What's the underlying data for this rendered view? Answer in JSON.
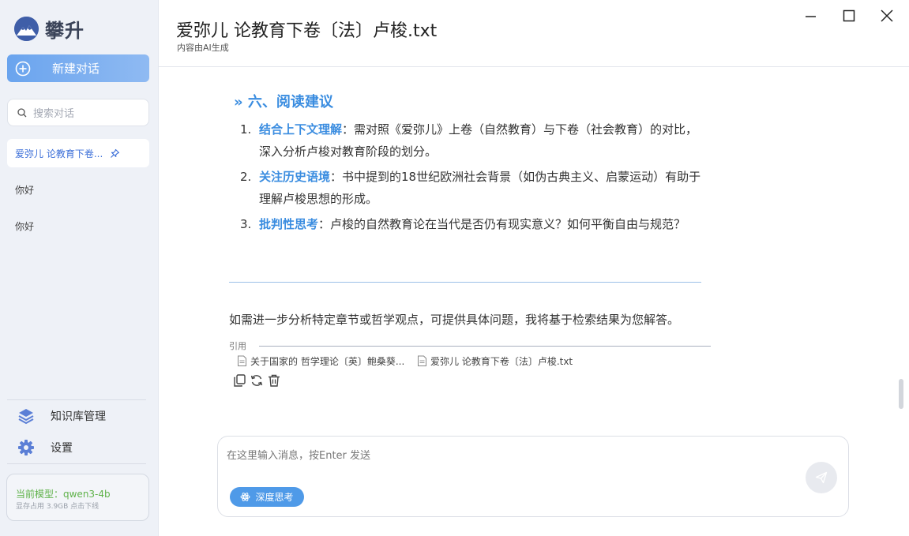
{
  "app": {
    "name": "攀升"
  },
  "sidebar": {
    "new_chat_label": "新建对话",
    "search_placeholder": "搜索对话",
    "conversations": [
      {
        "title": "爱弥儿 论教育下卷...",
        "pinned": true
      },
      {
        "title": "你好"
      },
      {
        "title": "你好"
      }
    ],
    "menu": [
      {
        "label": "知识库管理",
        "icon": "layers-icon"
      },
      {
        "label": "设置",
        "icon": "gear-icon"
      }
    ],
    "model": {
      "current": "当前模型：qwen3-4b",
      "memory": "显存占用 3.9GB 点击下线"
    }
  },
  "header": {
    "title": "爱弥儿 论教育下卷〔法〕卢梭.txt",
    "subtitle": "内容由AI生成"
  },
  "content": {
    "section_marker": "»",
    "section_heading": "六、阅读建议",
    "items": [
      {
        "num": "1.",
        "highlight": "结合上下文理解",
        "text": "：需对照《爱弥儿》上卷（自然教育）与下卷（社会教育）的对比，深入分析卢梭对教育阶段的划分。"
      },
      {
        "num": "2.",
        "highlight": "关注历史语境",
        "text": "：书中提到的18世纪欧洲社会背景（如伪古典主义、启蒙运动）有助于理解卢梭思想的形成。"
      },
      {
        "num": "3.",
        "highlight": "批判性思考",
        "text": "：卢梭的自然教育论在当代是否仍有现实意义？如何平衡自由与规范？"
      }
    ],
    "closing": "如需进一步分析特定章节或哲学观点，可提供具体问题，我将基于检索结果为您解答。",
    "citations_label": "引用",
    "citations": [
      {
        "title": "关于国家的 哲学理论〔英〕鲍桑葵..."
      },
      {
        "title": "爱弥儿 论教育下卷〔法〕卢梭.txt"
      }
    ]
  },
  "composer": {
    "placeholder": "在这里输入消息，按Enter 发送",
    "deep_think_label": "深度思考"
  },
  "colors": {
    "accent": "#3b8de0",
    "model_green": "#5fb24a"
  }
}
